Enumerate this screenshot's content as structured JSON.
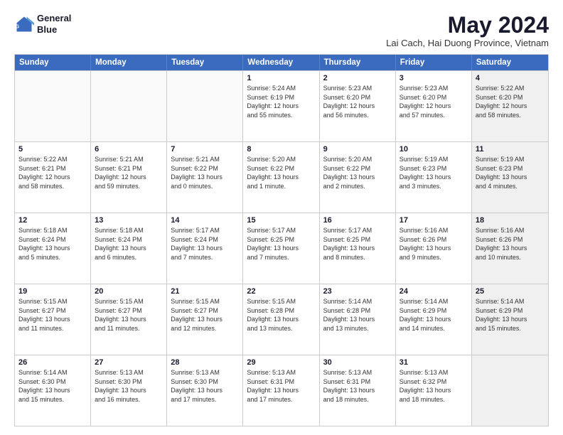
{
  "logo": {
    "line1": "General",
    "line2": "Blue"
  },
  "title": "May 2024",
  "subtitle": "Lai Cach, Hai Duong Province, Vietnam",
  "header_days": [
    "Sunday",
    "Monday",
    "Tuesday",
    "Wednesday",
    "Thursday",
    "Friday",
    "Saturday"
  ],
  "weeks": [
    [
      {
        "day": "",
        "info": "",
        "empty": true
      },
      {
        "day": "",
        "info": "",
        "empty": true
      },
      {
        "day": "",
        "info": "",
        "empty": true
      },
      {
        "day": "1",
        "info": "Sunrise: 5:24 AM\nSunset: 6:19 PM\nDaylight: 12 hours\nand 55 minutes."
      },
      {
        "day": "2",
        "info": "Sunrise: 5:23 AM\nSunset: 6:20 PM\nDaylight: 12 hours\nand 56 minutes."
      },
      {
        "day": "3",
        "info": "Sunrise: 5:23 AM\nSunset: 6:20 PM\nDaylight: 12 hours\nand 57 minutes."
      },
      {
        "day": "4",
        "info": "Sunrise: 5:22 AM\nSunset: 6:20 PM\nDaylight: 12 hours\nand 58 minutes.",
        "shaded": true
      }
    ],
    [
      {
        "day": "5",
        "info": "Sunrise: 5:22 AM\nSunset: 6:21 PM\nDaylight: 12 hours\nand 58 minutes."
      },
      {
        "day": "6",
        "info": "Sunrise: 5:21 AM\nSunset: 6:21 PM\nDaylight: 12 hours\nand 59 minutes."
      },
      {
        "day": "7",
        "info": "Sunrise: 5:21 AM\nSunset: 6:22 PM\nDaylight: 13 hours\nand 0 minutes."
      },
      {
        "day": "8",
        "info": "Sunrise: 5:20 AM\nSunset: 6:22 PM\nDaylight: 13 hours\nand 1 minute."
      },
      {
        "day": "9",
        "info": "Sunrise: 5:20 AM\nSunset: 6:22 PM\nDaylight: 13 hours\nand 2 minutes."
      },
      {
        "day": "10",
        "info": "Sunrise: 5:19 AM\nSunset: 6:23 PM\nDaylight: 13 hours\nand 3 minutes."
      },
      {
        "day": "11",
        "info": "Sunrise: 5:19 AM\nSunset: 6:23 PM\nDaylight: 13 hours\nand 4 minutes.",
        "shaded": true
      }
    ],
    [
      {
        "day": "12",
        "info": "Sunrise: 5:18 AM\nSunset: 6:24 PM\nDaylight: 13 hours\nand 5 minutes."
      },
      {
        "day": "13",
        "info": "Sunrise: 5:18 AM\nSunset: 6:24 PM\nDaylight: 13 hours\nand 6 minutes."
      },
      {
        "day": "14",
        "info": "Sunrise: 5:17 AM\nSunset: 6:24 PM\nDaylight: 13 hours\nand 7 minutes."
      },
      {
        "day": "15",
        "info": "Sunrise: 5:17 AM\nSunset: 6:25 PM\nDaylight: 13 hours\nand 7 minutes."
      },
      {
        "day": "16",
        "info": "Sunrise: 5:17 AM\nSunset: 6:25 PM\nDaylight: 13 hours\nand 8 minutes."
      },
      {
        "day": "17",
        "info": "Sunrise: 5:16 AM\nSunset: 6:26 PM\nDaylight: 13 hours\nand 9 minutes."
      },
      {
        "day": "18",
        "info": "Sunrise: 5:16 AM\nSunset: 6:26 PM\nDaylight: 13 hours\nand 10 minutes.",
        "shaded": true
      }
    ],
    [
      {
        "day": "19",
        "info": "Sunrise: 5:15 AM\nSunset: 6:27 PM\nDaylight: 13 hours\nand 11 minutes."
      },
      {
        "day": "20",
        "info": "Sunrise: 5:15 AM\nSunset: 6:27 PM\nDaylight: 13 hours\nand 11 minutes."
      },
      {
        "day": "21",
        "info": "Sunrise: 5:15 AM\nSunset: 6:27 PM\nDaylight: 13 hours\nand 12 minutes."
      },
      {
        "day": "22",
        "info": "Sunrise: 5:15 AM\nSunset: 6:28 PM\nDaylight: 13 hours\nand 13 minutes."
      },
      {
        "day": "23",
        "info": "Sunrise: 5:14 AM\nSunset: 6:28 PM\nDaylight: 13 hours\nand 13 minutes."
      },
      {
        "day": "24",
        "info": "Sunrise: 5:14 AM\nSunset: 6:29 PM\nDaylight: 13 hours\nand 14 minutes."
      },
      {
        "day": "25",
        "info": "Sunrise: 5:14 AM\nSunset: 6:29 PM\nDaylight: 13 hours\nand 15 minutes.",
        "shaded": true
      }
    ],
    [
      {
        "day": "26",
        "info": "Sunrise: 5:14 AM\nSunset: 6:30 PM\nDaylight: 13 hours\nand 15 minutes."
      },
      {
        "day": "27",
        "info": "Sunrise: 5:13 AM\nSunset: 6:30 PM\nDaylight: 13 hours\nand 16 minutes."
      },
      {
        "day": "28",
        "info": "Sunrise: 5:13 AM\nSunset: 6:30 PM\nDaylight: 13 hours\nand 17 minutes."
      },
      {
        "day": "29",
        "info": "Sunrise: 5:13 AM\nSunset: 6:31 PM\nDaylight: 13 hours\nand 17 minutes."
      },
      {
        "day": "30",
        "info": "Sunrise: 5:13 AM\nSunset: 6:31 PM\nDaylight: 13 hours\nand 18 minutes."
      },
      {
        "day": "31",
        "info": "Sunrise: 5:13 AM\nSunset: 6:32 PM\nDaylight: 13 hours\nand 18 minutes."
      },
      {
        "day": "",
        "info": "",
        "empty": true,
        "shaded": true
      }
    ]
  ]
}
